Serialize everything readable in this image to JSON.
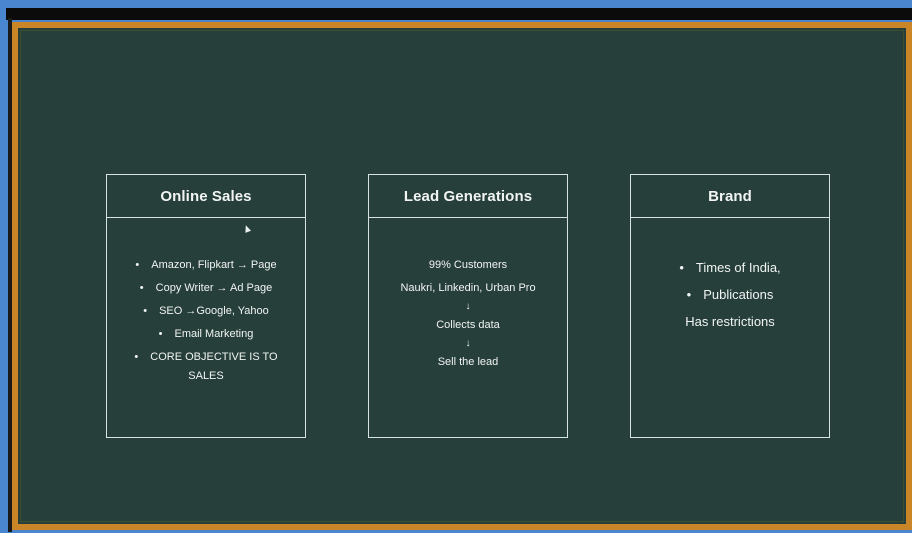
{
  "cards": {
    "online_sales": {
      "title": "Online Sales",
      "items": [
        "Amazon, Flipkart → Page",
        "Copy Writer → Ad Page",
        "SEO →Google, Yahoo",
        "Email Marketing",
        "CORE OBJECTIVE IS TO",
        "SALES"
      ]
    },
    "lead_generations": {
      "title": "Lead Generations",
      "lines": [
        "99% Customers",
        "Naukri, Linkedin, Urban Pro",
        "↓",
        "Collects data",
        "↓",
        "Sell the lead"
      ]
    },
    "brand": {
      "title": "Brand",
      "items": [
        "Times of India,",
        "Publications",
        "Has restrictions"
      ]
    }
  },
  "colors": {
    "board": "#263f3b",
    "frame": "#c98526",
    "chalk": "#f1f4f2",
    "outer": "#4a86d0"
  }
}
